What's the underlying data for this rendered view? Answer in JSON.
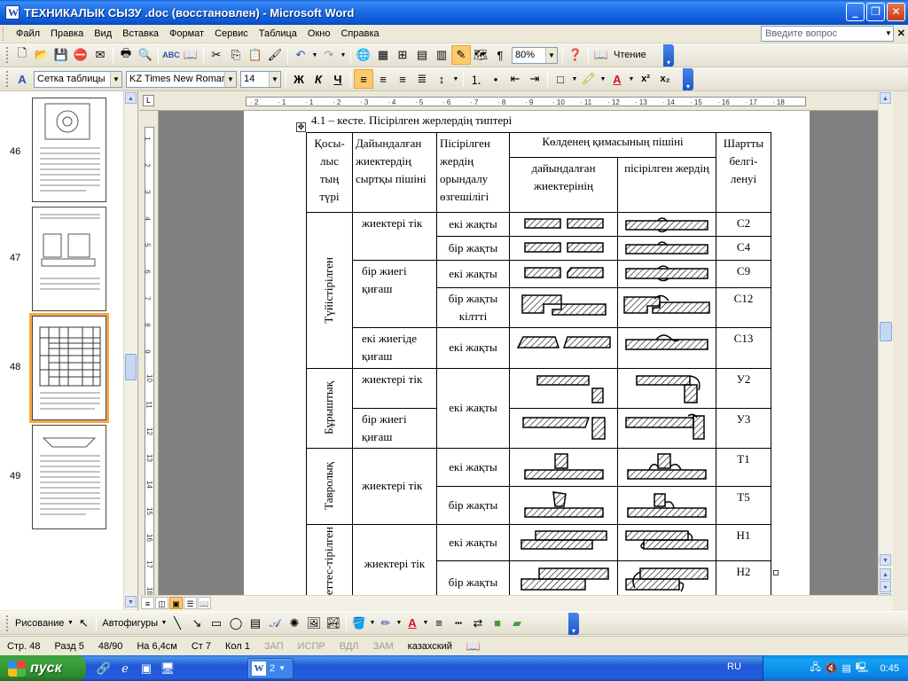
{
  "window": {
    "title": "ТЕХНИКАЛЫК СЫЗУ .doc (восстановлен) - Microsoft Word"
  },
  "menu": {
    "items": [
      "Файл",
      "Правка",
      "Вид",
      "Вставка",
      "Формат",
      "Сервис",
      "Таблица",
      "Окно",
      "Справка"
    ],
    "help_placeholder": "Введите вопрос"
  },
  "toolbar_standard": {
    "zoom": "80%",
    "reading_label": "Чтение"
  },
  "toolbar_format": {
    "style": "Сетка таблицы",
    "font": "KZ Times New Roman",
    "size": "14",
    "bold": "Ж",
    "italic": "К",
    "underline": "Ч"
  },
  "thumbnails": [
    {
      "page": "46"
    },
    {
      "page": "47"
    },
    {
      "page": "48"
    },
    {
      "page": "49"
    }
  ],
  "ruler": {
    "h_ticks": [
      "2",
      "1",
      "1",
      "2",
      "3",
      "4",
      "5",
      "6",
      "7",
      "8",
      "9",
      "10",
      "11",
      "12",
      "13",
      "14",
      "15",
      "16",
      "17",
      "18"
    ],
    "v_ticks": [
      "1",
      "2",
      "3",
      "4",
      "5",
      "6",
      "7",
      "8",
      "9",
      "10",
      "11",
      "12",
      "13",
      "14",
      "15",
      "16",
      "17",
      "18"
    ]
  },
  "document": {
    "caption": "4.1 – кесте. Пісірілген жерлердің типтері",
    "headers": {
      "col1": "Қосы-лыс тың түрі",
      "col2": "Дайындалған жиектердің сыртқы пішіні",
      "col3": "Пісірілген жердің орындалу өзгешілігі",
      "cross_section": "Көлденең қимасының пішіні",
      "sub_prepared": "дайындалған жиектерінің",
      "sub_welded": "пісірілген жердің",
      "symbol": "Шартты белгі-ленуі"
    },
    "groups": [
      {
        "type": "Түйістірілген",
        "rows": [
          {
            "edge": "жиектері тік",
            "side": "екі жақты",
            "symbol": "С2"
          },
          {
            "edge": "",
            "side": "бір жақты",
            "symbol": "С4"
          },
          {
            "edge": "бір жиегі қиғаш",
            "side": "екі жақты",
            "symbol": "С9"
          },
          {
            "edge": "",
            "side": "бір жақты кілтті",
            "symbol": "С12"
          },
          {
            "edge": "екі жиегіде қиғаш",
            "side": "екі жақты",
            "symbol": "С13"
          }
        ]
      },
      {
        "type": "Бұрыштық",
        "rows": [
          {
            "edge": "жиектері тік",
            "side": "екі жақты",
            "symbol": "У2"
          },
          {
            "edge": "бір жиегі қиғаш",
            "side": "",
            "symbol": "У3"
          }
        ]
      },
      {
        "type": "Тавролық",
        "rows": [
          {
            "edge": "жиектері тік",
            "side": "екі жақты",
            "symbol": "Т1"
          },
          {
            "edge": "",
            "side": "бір жақты",
            "symbol": "Т5"
          }
        ]
      },
      {
        "type": "Беттес-тірілген",
        "rows": [
          {
            "edge": "жиектері тік",
            "side": "екі жақты",
            "symbol": "Н1"
          },
          {
            "edge": "",
            "side": "бір жақты",
            "symbol": "Н2"
          }
        ]
      }
    ]
  },
  "drawbar": {
    "draw_label": "Рисование",
    "autoshapes_label": "Автофигуры"
  },
  "status": {
    "page": "Стр. 48",
    "section": "Разд 5",
    "pages": "48/90",
    "at": "На 6,4см",
    "line": "Ст 7",
    "col": "Кол 1",
    "rec": "ЗАП",
    "trk": "ИСПР",
    "ext": "ВДЛ",
    "ovr": "ЗАМ",
    "lang": "казахский"
  },
  "taskbar": {
    "start_label": "пуск",
    "task_count": "2",
    "lang": "RU",
    "clock": "0:45"
  }
}
